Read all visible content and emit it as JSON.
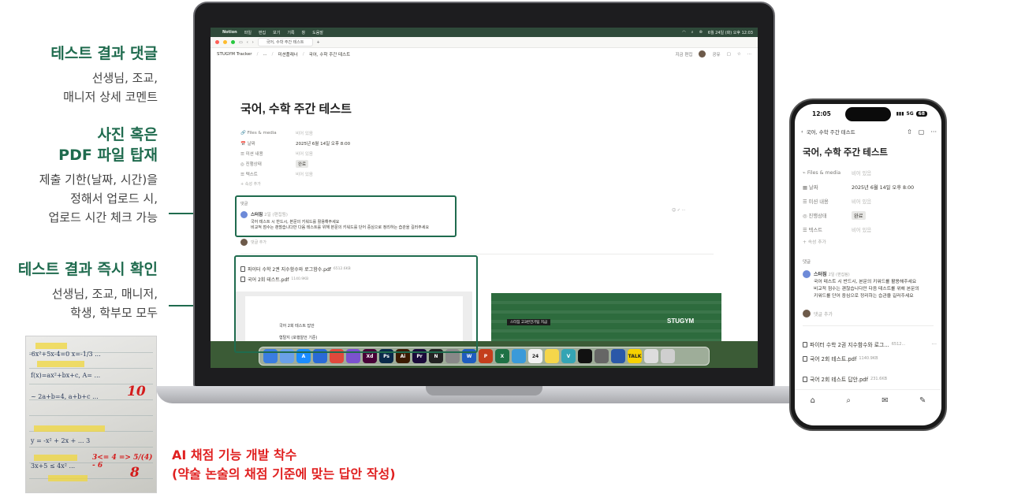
{
  "annotations": [
    {
      "title": "테스트 결과 댓글",
      "desc": [
        "선생님, 조교,",
        "매니저 상세 코멘트"
      ]
    },
    {
      "title": [
        "사진 혹은",
        "PDF 파일 탑재"
      ],
      "desc": [
        "제출 기한(날짜, 시간)을",
        "정해서 업로드 시,",
        "업로드 시간 체크 가능"
      ]
    },
    {
      "title": "테스트 결과 즉시 확인",
      "desc": [
        "선생님, 조교, 매니저,",
        "학생, 학부모 모두"
      ]
    }
  ],
  "ai_note": {
    "line1": "AI 채점 기능 개발 착수",
    "line2": "(약술 논술의 채점 기준에 맞는 답안 작성)"
  },
  "photo": {
    "scores": [
      "10",
      "8"
    ],
    "note": "3<= 4 => 5/(4) - 6"
  },
  "mac": {
    "menubar": {
      "app": "Notion",
      "items": [
        "파일",
        "편집",
        "보기",
        "기록",
        "창",
        "도움말"
      ],
      "clock": "6월 24일 (화) 오후 12:03"
    },
    "tab": "국어, 수학 주간 테스트",
    "breadcrumb": [
      "STUGYM Tracker",
      "...",
      "미션플래너",
      "국어, 수학 주간 테스트"
    ],
    "toolbar": {
      "edited": "지금 편집",
      "share": "공유"
    }
  },
  "page": {
    "title": "국어, 수학 주간 테스트",
    "properties": [
      {
        "icon": "🔗",
        "key": "Files & media",
        "value": "비어 있음",
        "empty": true
      },
      {
        "icon": "📅",
        "key": "날짜",
        "value": "2025년 6월 14일 오후 8:00",
        "empty": false
      },
      {
        "icon": "☰",
        "key": "미션 내용",
        "value": "비어 있음",
        "empty": true
      },
      {
        "icon": "◎",
        "key": "진행상태",
        "value": "완료",
        "empty": false,
        "badge": true
      },
      {
        "icon": "☰",
        "key": "텍스트",
        "value": "비어 있음",
        "empty": true
      }
    ],
    "add_property": "+ 속성 추가",
    "comments_label": "댓글",
    "comment": {
      "author": "스터짐",
      "time": "2일 (편집됨)",
      "lines": [
        "국어 테스트 시 반드시, 본문의 키워드를 활용해주세요",
        "비교적 점수는 괜찮습니다만 다음 테스트를 위해 본문의 키워드를 단어 중심으로 정리하는 습관을 길러주세요"
      ]
    },
    "add_comment": "댓글 추가",
    "files": [
      {
        "name": "파이터 수학 2권 지수함수와 로그함수.pdf",
        "size": "6512.6KB"
      },
      {
        "name": "국어 2회 테스트.pdf",
        "size": "1140.9KB"
      }
    ],
    "thumb1": {
      "title": "국어 2회 테스트 답안",
      "sub": "형탈지 (포행알언 기준)"
    },
    "thumb2": {
      "label": "스터짐 고3반건기팀 지금",
      "logo": "STUGYM"
    }
  },
  "dock": [
    {
      "label": "",
      "color": "#3a7de0"
    },
    {
      "label": "",
      "color": "#6aa0e8"
    },
    {
      "label": "A",
      "color": "#1a8cff"
    },
    {
      "label": "",
      "color": "#2a6ad6"
    },
    {
      "label": "",
      "color": "#e0493c"
    },
    {
      "label": "",
      "color": "#7b52cf"
    },
    {
      "label": "Xd",
      "color": "#470137"
    },
    {
      "label": "Ps",
      "color": "#0a2a4a"
    },
    {
      "label": "Ai",
      "color": "#3a1a00"
    },
    {
      "label": "Pr",
      "color": "#1a0a3a"
    },
    {
      "label": "N",
      "color": "#222222"
    },
    {
      "label": "",
      "color": "#888888"
    },
    {
      "label": "W",
      "color": "#1f5cbf"
    },
    {
      "label": "P",
      "color": "#c43e1c"
    },
    {
      "label": "X",
      "color": "#1e7145"
    },
    {
      "label": "",
      "color": "#3a9ad9"
    },
    {
      "label": "24",
      "color": "#f2f2f2"
    },
    {
      "label": "",
      "color": "#f5d64a"
    },
    {
      "label": "V",
      "color": "#34a4b4"
    },
    {
      "label": "",
      "color": "#111111"
    },
    {
      "label": "",
      "color": "#666666"
    },
    {
      "label": "",
      "color": "#2b58a8"
    },
    {
      "label": "TALK",
      "color": "#f7d100"
    },
    {
      "label": "",
      "color": "#dddddd"
    },
    {
      "label": "",
      "color": "#cfcfcf"
    }
  ],
  "phone": {
    "time": "12:05",
    "network": "5G",
    "battery": "68",
    "nav_title": "국어, 수학 주간 테스트",
    "title": "국어, 수학 주간 테스트",
    "properties": [
      {
        "key": "Files & media",
        "value": "비어 있음",
        "empty": true
      },
      {
        "key": "날짜",
        "value": "2025년 6월 14일 오후 8:00",
        "empty": false
      },
      {
        "key": "미션 내용",
        "value": "비어 있음",
        "empty": true
      },
      {
        "key": "진행상태",
        "value": "완료",
        "empty": false,
        "badge": true
      },
      {
        "key": "텍스트",
        "value": "비어 있음",
        "empty": true
      }
    ],
    "add_property": "+ 속성 추가",
    "comments_label": "댓글",
    "comment": {
      "author": "스터짐",
      "time": "2일 (편집됨)",
      "lines": [
        "국어 테스트 시 반드시, 본문의 키워드를 활용해주세요",
        "비교적 점수는 괜찮습니다만 다음 테스트를 위해 본문의",
        "키워드를 단어 중심으로 정리하는 습관을 길러주세요"
      ]
    },
    "add_comment": "댓글 추가",
    "files": [
      {
        "name": "파이터 수학 2권 지수함수와 로그...",
        "size": "6512..."
      },
      {
        "name": "국어 2회 테스트.pdf",
        "size": "1140.9KB"
      },
      {
        "name": "국어 2회 테스트 답안.pdf",
        "size": "231.6KB"
      }
    ]
  },
  "colors": {
    "accent": "#1f6b4e",
    "alert": "#e02020"
  }
}
